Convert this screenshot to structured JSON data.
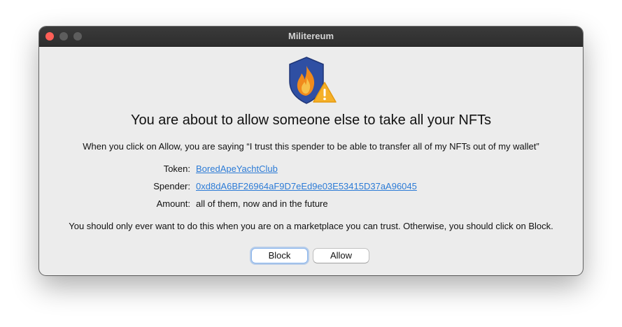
{
  "window": {
    "title": "Militereum"
  },
  "dialog": {
    "icon": "shield-flame-warning-icon",
    "headline": "You are about to allow someone else to take all your NFTs",
    "explanation": "When you click on Allow, you are saying “I trust this spender to be able to transfer all of my NFTs out of my wallet”",
    "details": {
      "token_label": "Token:",
      "token_value": "BoredApeYachtClub",
      "spender_label": "Spender:",
      "spender_value": "0xd8dA6BF26964aF9D7eEd9e03E53415D37aA96045",
      "amount_label": "Amount:",
      "amount_value": "all of them, now and in the future"
    },
    "warning": "You should only ever want to do this when you are on a marketplace you can trust. Otherwise, you should click on Block.",
    "buttons": {
      "block_label": "Block",
      "allow_label": "Allow"
    }
  },
  "colors": {
    "link": "#2c7bd6",
    "shield": "#2f4fa3",
    "flame": "#f08a1c",
    "warning": "#f5b028"
  }
}
